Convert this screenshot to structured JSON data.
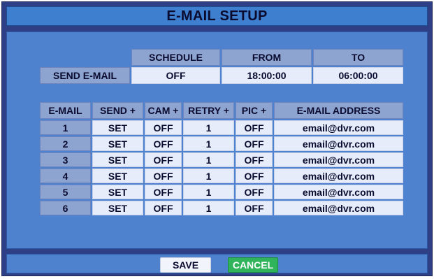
{
  "title": "E-MAIL SETUP",
  "schedule_table": {
    "headers": [
      "SCHEDULE",
      "FROM",
      "TO"
    ],
    "row_label": "SEND E-MAIL",
    "values": [
      "OFF",
      "18:00:00",
      "06:00:00"
    ]
  },
  "email_table": {
    "headers": [
      "E-MAIL",
      "SEND +",
      "CAM +",
      "RETRY +",
      "PIC +",
      "E-MAIL ADDRESS"
    ],
    "rows": [
      [
        "1",
        "SET",
        "OFF",
        "1",
        "OFF",
        "email@dvr.com"
      ],
      [
        "2",
        "SET",
        "OFF",
        "1",
        "OFF",
        "email@dvr.com"
      ],
      [
        "3",
        "SET",
        "OFF",
        "1",
        "OFF",
        "email@dvr.com"
      ],
      [
        "4",
        "SET",
        "OFF",
        "1",
        "OFF",
        "email@dvr.com"
      ],
      [
        "5",
        "SET",
        "OFF",
        "1",
        "OFF",
        "email@dvr.com"
      ],
      [
        "6",
        "SET",
        "OFF",
        "1",
        "OFF",
        "email@dvr.com"
      ]
    ]
  },
  "buttons": {
    "save": "SAVE",
    "cancel": "CANCEL"
  },
  "colors": {
    "background": "#2f3f86",
    "title_bar": "#3e7fd0",
    "panel": "#4e82ce",
    "header_cell": "#8ea4d0",
    "value_cell": "#e6ecf9",
    "cancel_button": "#2fb35b"
  }
}
